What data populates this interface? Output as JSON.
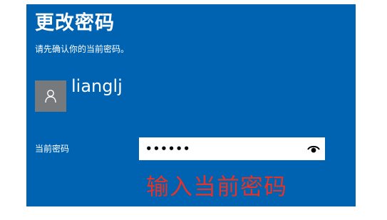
{
  "dialog": {
    "title": "更改密码",
    "subtitle": "请先确认你的当前密码。",
    "username": "lianglj",
    "avatar_icon": "user-icon"
  },
  "password_field": {
    "label": "当前密码",
    "value": "••••••",
    "reveal_icon": "eye-icon"
  },
  "annotation": {
    "text": "输入当前密码",
    "color": "#e0342a"
  },
  "colors": {
    "panel_background": "#0063b1",
    "avatar_background": "#777a7d"
  }
}
